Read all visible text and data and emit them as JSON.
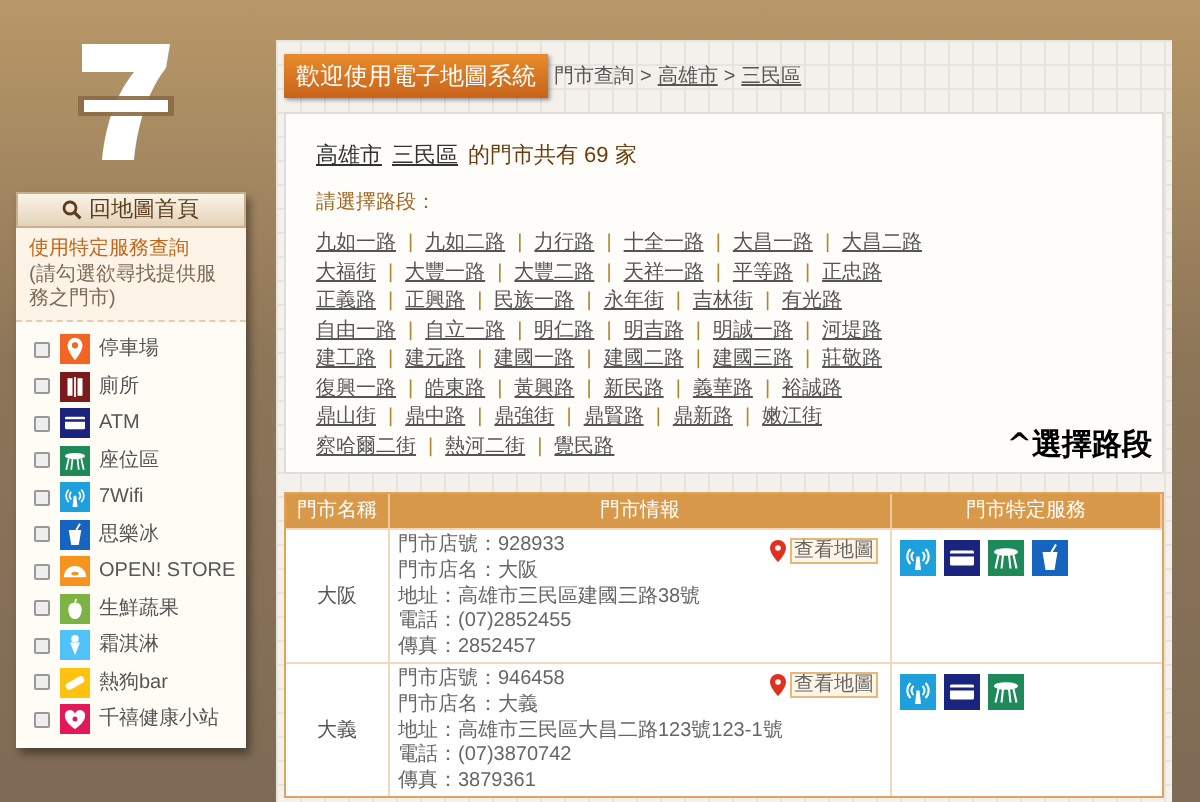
{
  "home_button": {
    "label": "回地圖首頁"
  },
  "service_filter": {
    "title": "使用特定服務查詢",
    "subtitle": "(請勾選欲尋找提供服務之門市)",
    "items": [
      {
        "kind": "parking",
        "label": "停車場",
        "checked": false,
        "color": "#f26522"
      },
      {
        "kind": "toilet",
        "label": "廁所",
        "checked": false,
        "color": "#7a1c1c"
      },
      {
        "kind": "atm",
        "label": "ATM",
        "checked": false,
        "color": "#1a237e"
      },
      {
        "kind": "seating",
        "label": "座位區",
        "checked": false,
        "color": "#1e8a5a"
      },
      {
        "kind": "wifi",
        "label": "7Wifi",
        "checked": false,
        "color": "#1ea0dc"
      },
      {
        "kind": "slush",
        "label": "思樂冰",
        "checked": false,
        "color": "#1565c0"
      },
      {
        "kind": "open",
        "label": "OPEN! STORE",
        "checked": false,
        "color": "#f7941d"
      },
      {
        "kind": "fruit",
        "label": "生鮮蔬果",
        "checked": false,
        "color": "#7cb342"
      },
      {
        "kind": "icecream",
        "label": "霜淇淋",
        "checked": false,
        "color": "#4fc3f7"
      },
      {
        "kind": "bar",
        "label": "熱狗bar",
        "checked": false,
        "color": "#ffc20e"
      },
      {
        "kind": "health",
        "label": "千禧健康小站",
        "checked": false,
        "color": "#e2185b"
      }
    ]
  },
  "title_button": {
    "label": "歡迎使用電子地圖系統"
  },
  "breadcrumb": [
    {
      "label": "門市查詢",
      "link": false
    },
    {
      "label": "高雄市",
      "link": true
    },
    {
      "label": "三民區",
      "link": true
    }
  ],
  "breadcrumb_separator": ">",
  "summary": {
    "city": "高雄市",
    "district": "三民區",
    "text": "的門市共有 69 家"
  },
  "road_prompt": "請選擇路段：",
  "road_rows": [
    [
      "九如一路",
      "九如二路",
      "力行路",
      "十全一路",
      "大昌一路",
      "大昌二路"
    ],
    [
      "大福街",
      "大豐一路",
      "大豐二路",
      "天祥一路",
      "平等路",
      "正忠路"
    ],
    [
      "正義路",
      "正興路",
      "民族一路",
      "永年街",
      "吉林街",
      "有光路"
    ],
    [
      "自由一路",
      "自立一路",
      "明仁路",
      "明吉路",
      "明誠一路",
      "河堤路"
    ],
    [
      "建工路",
      "建元路",
      "建國一路",
      "建國二路",
      "建國三路",
      "莊敬路"
    ],
    [
      "復興一路",
      "皓東路",
      "黃興路",
      "新民路",
      "義華路",
      "裕誠路"
    ],
    [
      "鼎山街",
      "鼎中路",
      "鼎強街",
      "鼎賢路",
      "鼎新路",
      "嫩江街"
    ],
    [
      "察哈爾二街",
      "熱河二街",
      "覺民路"
    ]
  ],
  "road_separator": "|",
  "annotation": "^選擇路段",
  "table": {
    "columns": [
      "門市名稱",
      "門市情報",
      "門市特定服務"
    ],
    "rows": [
      {
        "name": "大阪",
        "info": [
          "門市店號：928933",
          "門市店名：大阪",
          "地址：高雄市三民區建國三路38號",
          "電話：(07)2852455",
          "傳真：2852457"
        ],
        "map_button": "查看地圖",
        "services": [
          {
            "kind": "wifi",
            "color": "#1ea0dc"
          },
          {
            "kind": "atm",
            "color": "#1a237e"
          },
          {
            "kind": "seating",
            "color": "#1e8a5a"
          },
          {
            "kind": "slush",
            "color": "#1565c0"
          }
        ]
      },
      {
        "name": "大義",
        "info": [
          "門市店號：946458",
          "門市店名：大義",
          "地址：高雄市三民區大昌二路123號123-1號",
          "電話：(07)3870742",
          "傳真：3879361"
        ],
        "map_button": "查看地圖",
        "services": [
          {
            "kind": "wifi",
            "color": "#1ea0dc"
          },
          {
            "kind": "atm",
            "color": "#1a237e"
          },
          {
            "kind": "seating",
            "color": "#1e8a5a"
          }
        ]
      }
    ]
  }
}
